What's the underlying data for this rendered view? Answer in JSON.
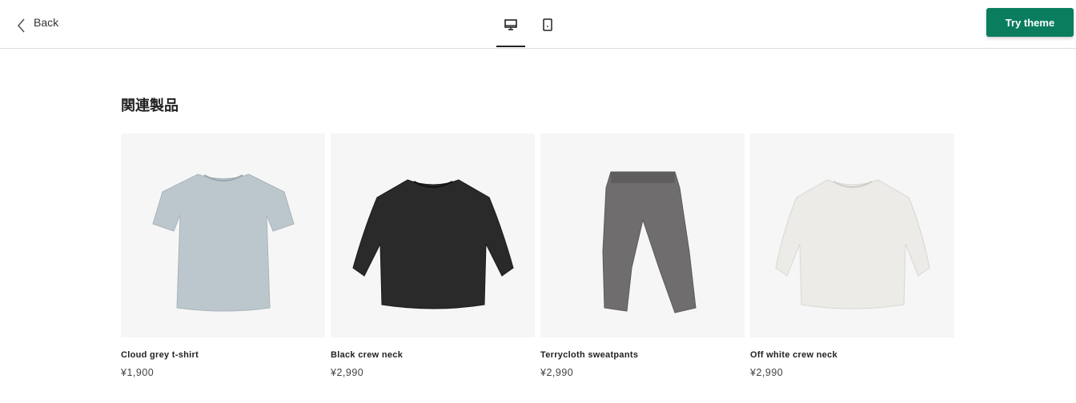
{
  "topbar": {
    "back_label": "Back",
    "device_views": [
      {
        "name": "desktop-icon",
        "active": true
      },
      {
        "name": "mobile-icon",
        "active": false
      }
    ],
    "try_theme_label": "Try theme",
    "accent_color": "#0a7d5f"
  },
  "section": {
    "title": "関連製品"
  },
  "products": [
    {
      "name": "Cloud grey t-shirt",
      "price": "¥1,900",
      "image": "grey-tshirt",
      "color": "#bcc7cd"
    },
    {
      "name": "Black crew neck",
      "price": "¥2,990",
      "image": "black-sweatshirt",
      "color": "#2a2a2a"
    },
    {
      "name": "Terrycloth sweatpants",
      "price": "¥2,990",
      "image": "grey-sweatpants",
      "color": "#6f6d6d"
    },
    {
      "name": "Off white crew neck",
      "price": "¥2,990",
      "image": "offwhite-sweatshirt",
      "color": "#ecebe7"
    }
  ]
}
